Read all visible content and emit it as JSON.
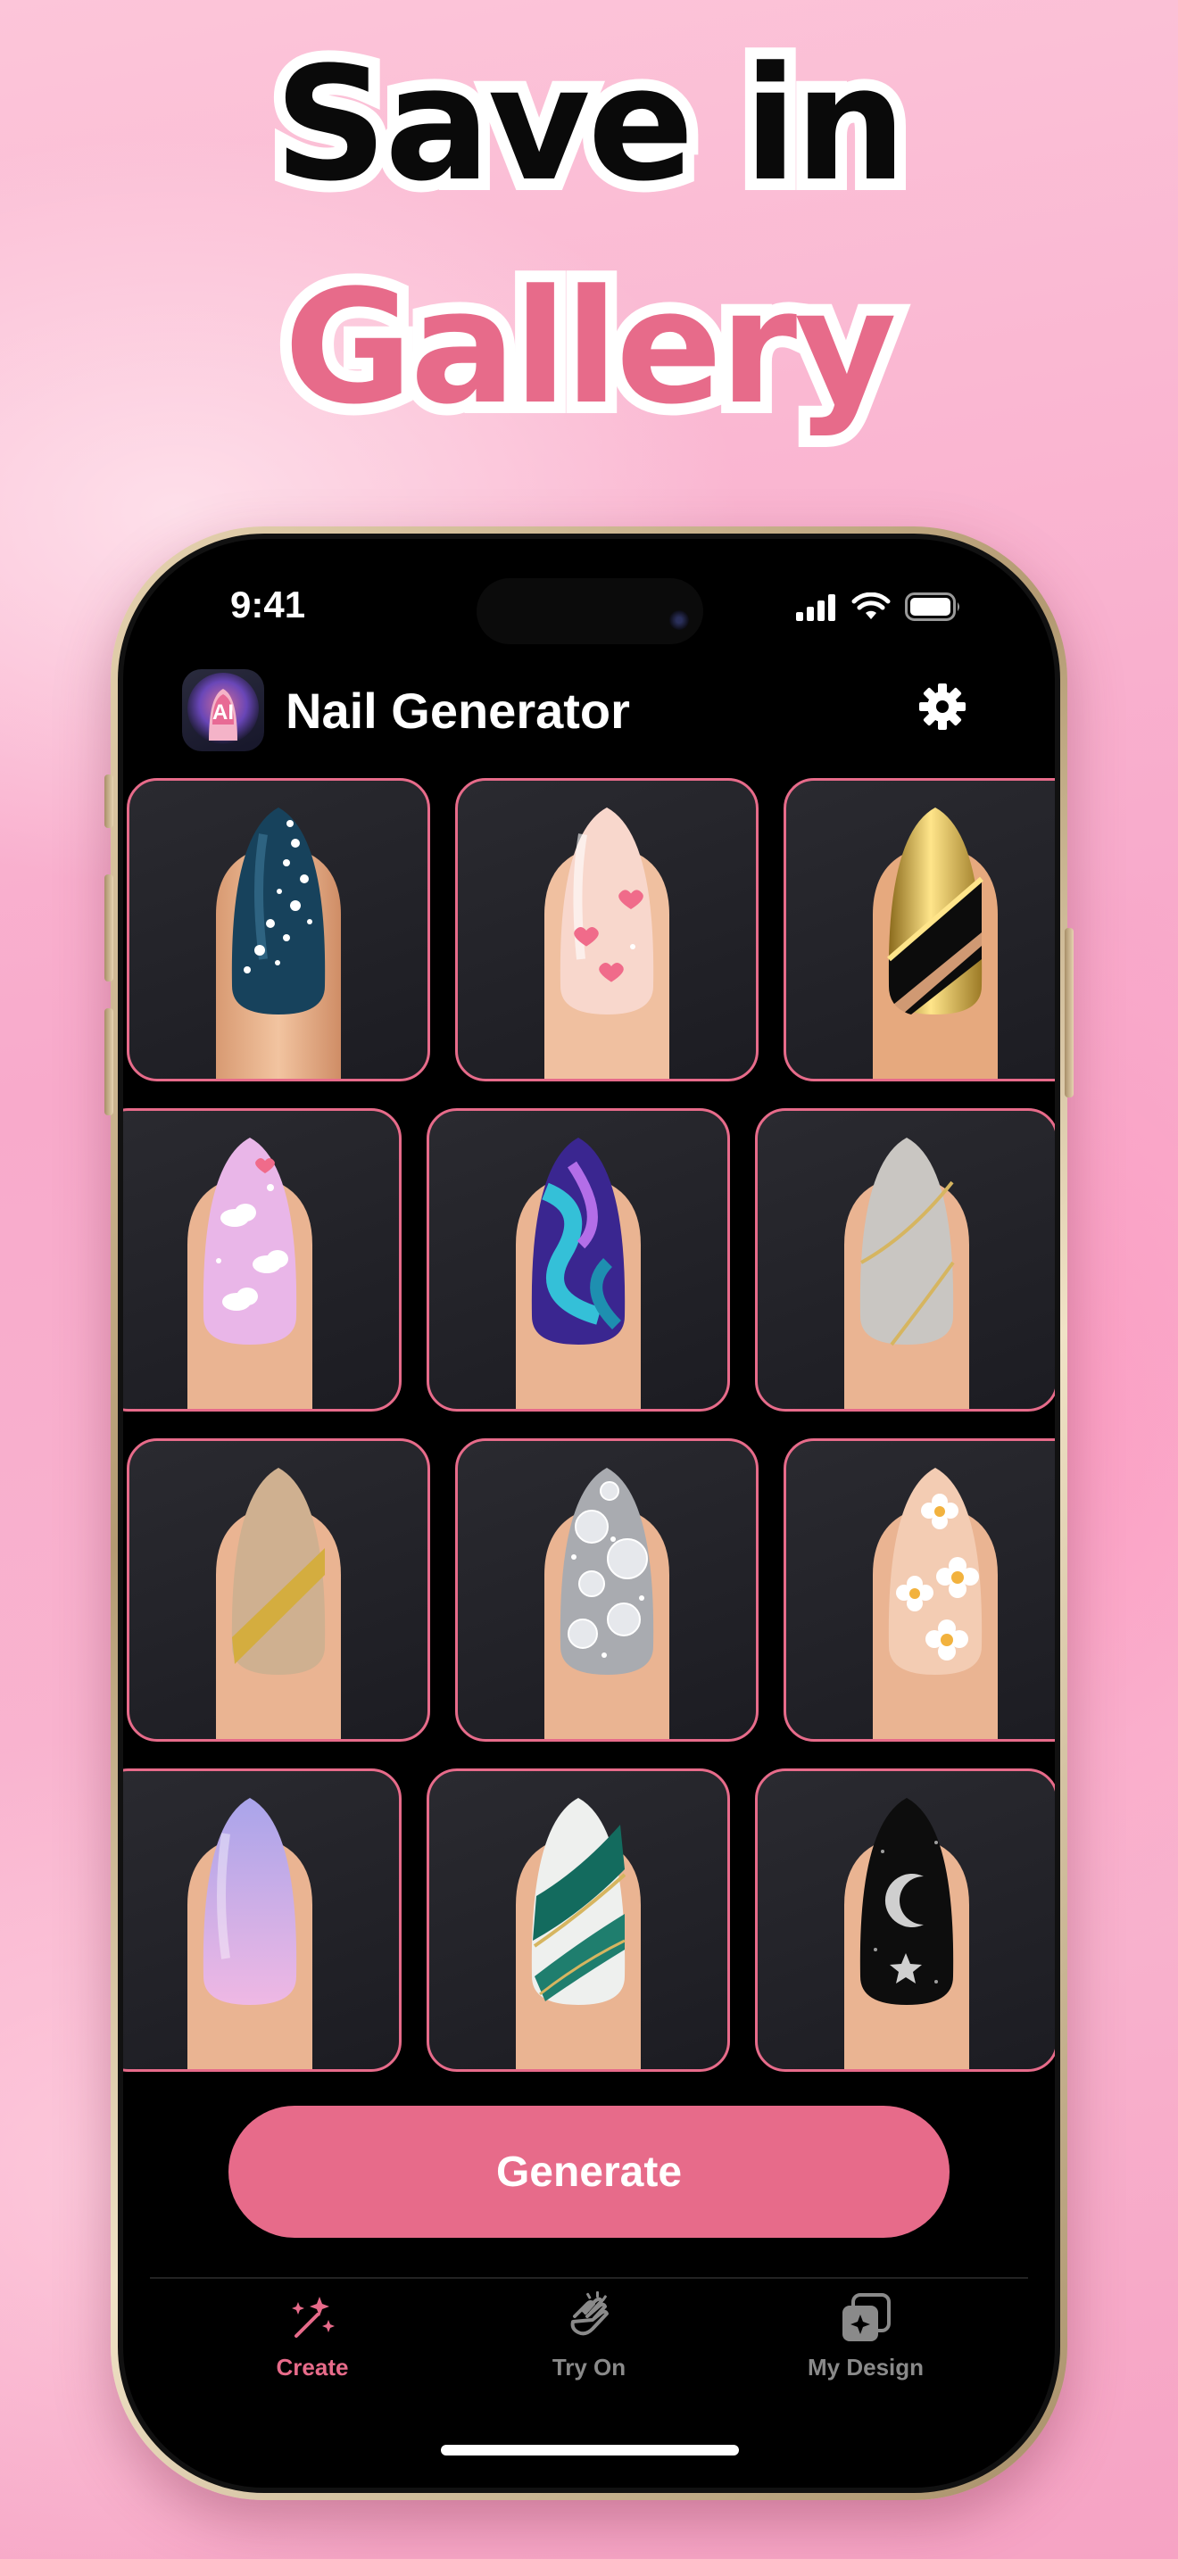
{
  "headline": {
    "line1": "Save in",
    "line2": "Gallery"
  },
  "status_bar": {
    "time": "9:41"
  },
  "header": {
    "title": "Nail Generator",
    "app_icon_text": "AI"
  },
  "designs": [
    "navy-polka-dot",
    "pink-hearts",
    "gold-black-chrome",
    "lilac-clouds",
    "purple-teal-swirl",
    "grey-gold-lines",
    "nude-gold-stripe",
    "silver-rhinestones",
    "daisy-flowers",
    "lavender-ombre",
    "green-white-marble",
    "black-moon-star"
  ],
  "generate_button": {
    "label": "Generate"
  },
  "tabs": [
    {
      "label": "Create",
      "icon": "magic-wand-icon",
      "active": true
    },
    {
      "label": "Try On",
      "icon": "clapping-hands-icon",
      "active": false
    },
    {
      "label": "My Design",
      "icon": "gallery-icon",
      "active": false
    }
  ],
  "colors": {
    "accent": "#e76b8a",
    "screen_bg": "#000000",
    "tile_bg": "#222228",
    "inactive_tab": "#8a8a8a"
  }
}
